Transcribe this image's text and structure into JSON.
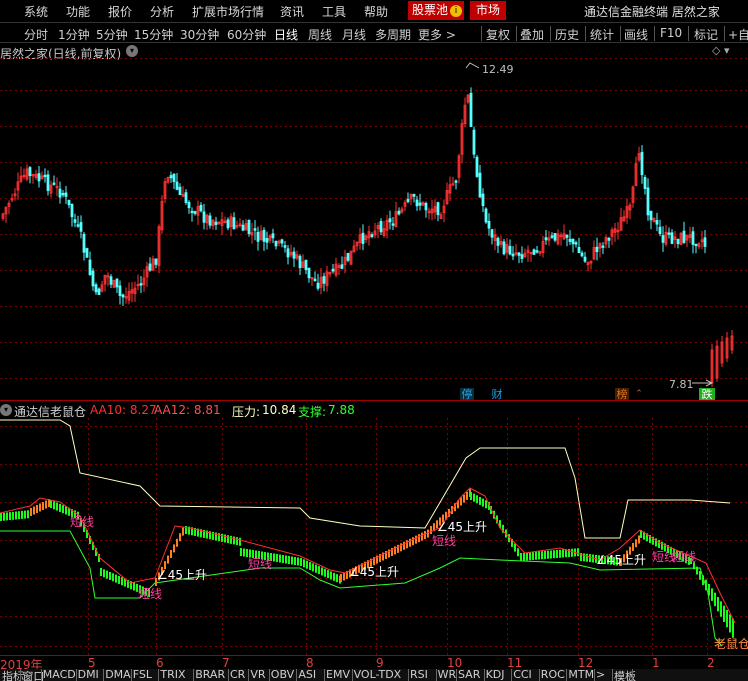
{
  "menu": {
    "items": [
      "系统",
      "功能",
      "报价",
      "分析",
      "扩展市场行情",
      "资讯",
      "工具",
      "帮助"
    ],
    "pool_label": "股票池",
    "pool_mark": "i",
    "market_label": "市场",
    "app_title": "通达信金融终端 居然之家"
  },
  "toolbar": {
    "periods": [
      "分时",
      "1分钟",
      "5分钟",
      "15分钟",
      "30分钟",
      "60分钟",
      "日线",
      "周线",
      "月线",
      "多周期",
      "更多"
    ],
    "more_arrow": ">",
    "active_period": "日线",
    "actions": [
      "复权",
      "叠加",
      "历史",
      "统计",
      "画线",
      "F10",
      "标记",
      "+自选"
    ]
  },
  "chart": {
    "title": "居然之家(日线,前复权)",
    "high_label": "12.49",
    "low_label": "7.81",
    "badges": [
      {
        "text": "停",
        "color": "#22a0e0"
      },
      {
        "text": "财",
        "color": "#22a0e0"
      },
      {
        "text": "榜",
        "color": "#e07020"
      },
      {
        "text": "跌",
        "color": "#20b020"
      }
    ],
    "colors": {
      "up": "#ff3232",
      "down": "#54ffff",
      "grid": "#7a0000"
    }
  },
  "indicator": {
    "name": "通达信老鼠仓",
    "aa10_label": "AA10: 8.27",
    "aa12_label": "AA12: 8.81",
    "pressure_label": "压力:",
    "pressure_value": "10.84",
    "support_label": "支撑:",
    "support_value": "7.88",
    "annotations": {
      "short": "短线",
      "rise": "45上升",
      "rat": "老鼠仓"
    },
    "colors": {
      "aa10": "#ff3030",
      "aa12": "#ff5050",
      "pressure": "#ffffc0",
      "support": "#30ff30",
      "rise_bar": "#ff7f1e",
      "fall_bar": "#19ff19"
    }
  },
  "dates": [
    "2019年",
    "5",
    "6",
    "7",
    "8",
    "9",
    "10",
    "11",
    "12",
    "1",
    "2"
  ],
  "bottom_tabs": [
    "指标",
    "窗口",
    "MACD",
    "DMI",
    "DMA",
    "FSL",
    "TRIX",
    "BRAR",
    "CR",
    "VR",
    "OBV",
    "ASI",
    "EMV",
    "VOL-TDX",
    "RSI",
    "WR",
    "SAR",
    "KDJ",
    "CCI",
    "ROC",
    "MTM",
    ">",
    "模板"
  ],
  "chart_data": {
    "type": "candlestick",
    "title": "居然之家(日线,前复权)",
    "price_high": 12.49,
    "price_low": 7.81,
    "indicator": {
      "name": "通达信老鼠仓",
      "AA10": 8.27,
      "AA12": 8.81,
      "pressure": 10.84,
      "support": 7.88
    },
    "x_tick_labels": [
      "2019年",
      "5",
      "6",
      "7",
      "8",
      "9",
      "10",
      "11",
      "12",
      "1",
      "2"
    ]
  }
}
